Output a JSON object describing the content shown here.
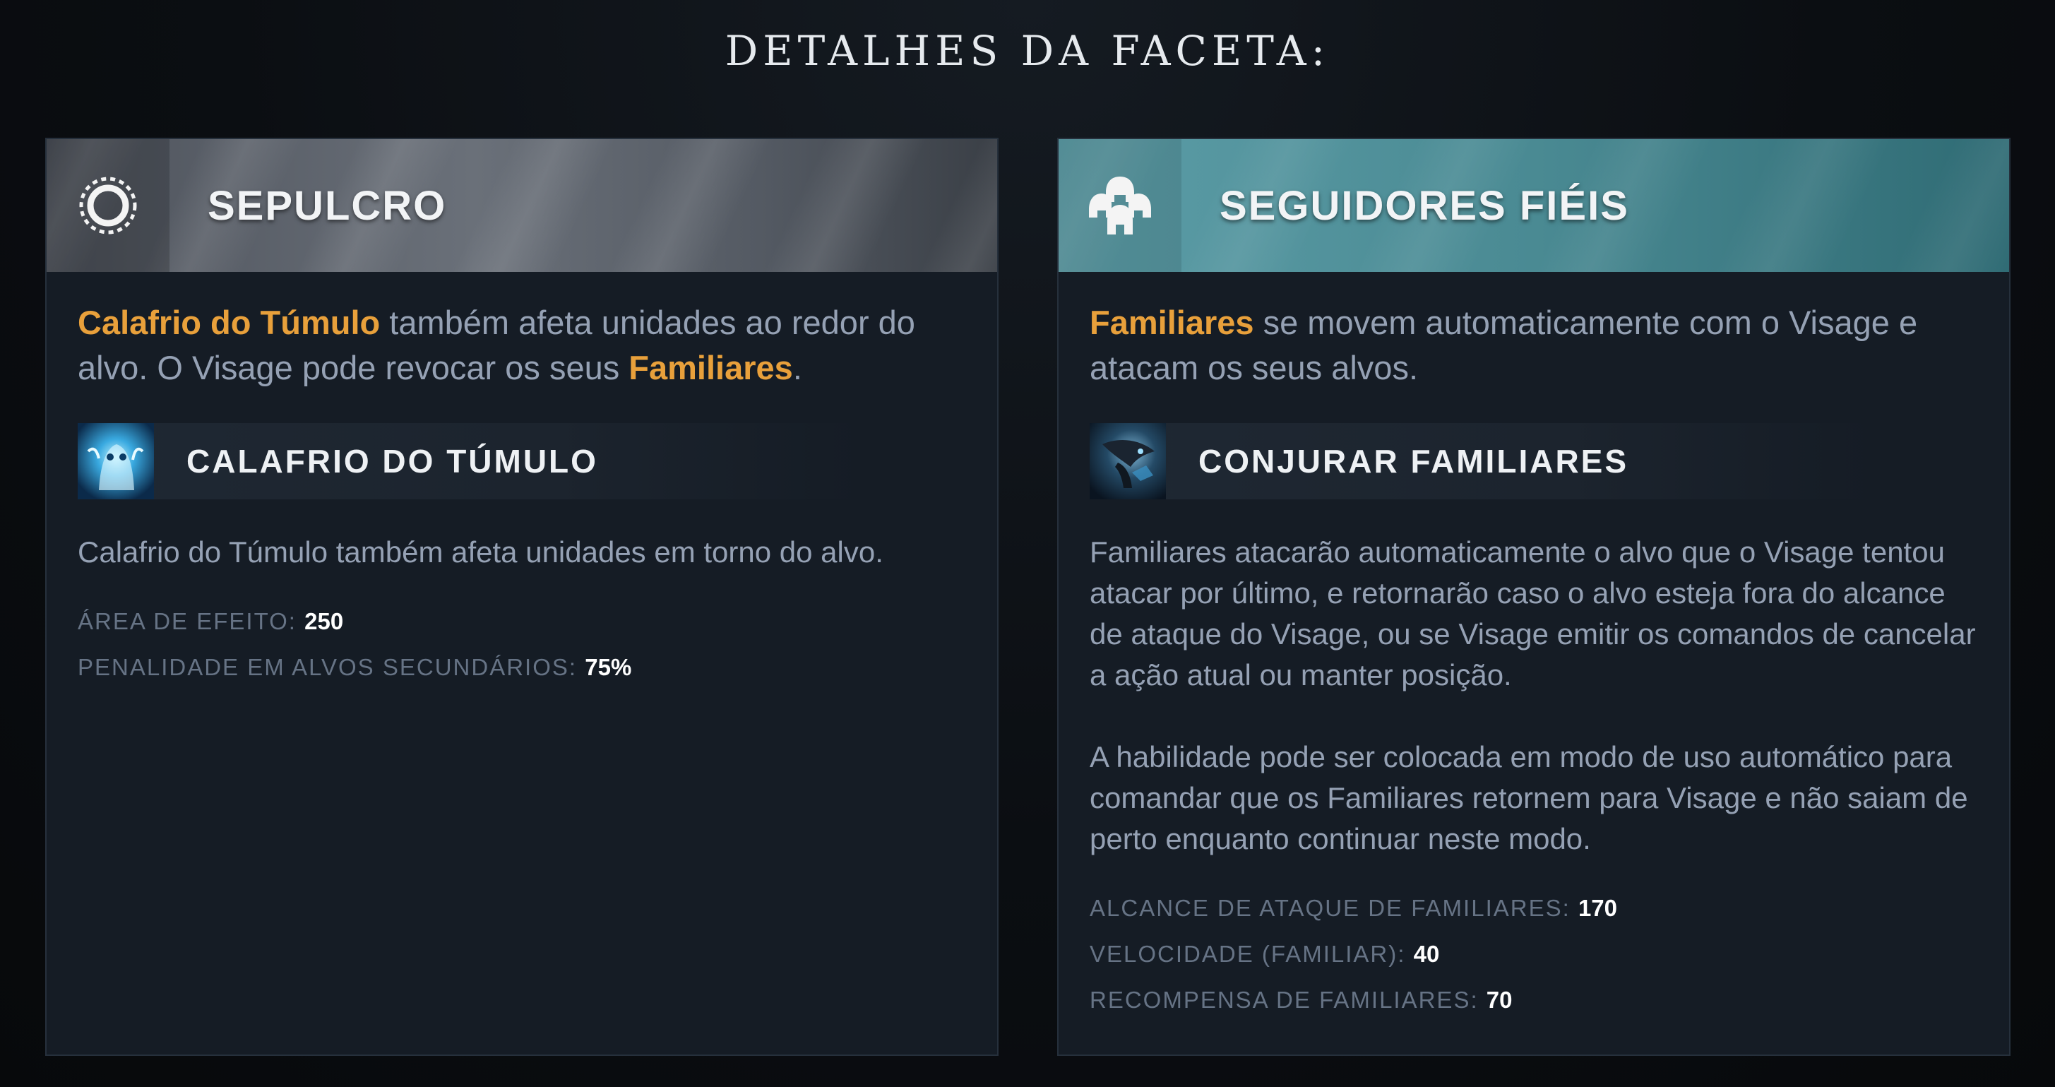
{
  "page": {
    "title": "DETALHES DA FACETA:"
  },
  "colors": {
    "highlight": "#e8a03b",
    "left_header": "#5a6069",
    "right_header": "#4a8a93",
    "card_bg": "#151c25"
  },
  "left_card": {
    "icon": "circle-ring-icon",
    "title": "SEPULCRO",
    "desc_parts": [
      {
        "text": "Calafrio do Túmulo",
        "highlight": true
      },
      {
        "text": " também afeta unidades ao redor do alvo. O Visage pode revocar os seus ",
        "highlight": false
      },
      {
        "text": "Familiares",
        "highlight": true
      },
      {
        "text": ".",
        "highlight": false
      }
    ],
    "ability": {
      "icon": "grave-chill-icon",
      "name": "CALAFRIO DO TÚMULO",
      "description": "Calafrio do Túmulo também afeta unidades em torno do alvo.",
      "stats": [
        {
          "label": "ÁREA DE EFEITO:",
          "value": "250"
        },
        {
          "label": "PENALIDADE EM ALVOS SECUNDÁRIOS:",
          "value": "75%"
        }
      ]
    }
  },
  "right_card": {
    "icon": "helmets-group-icon",
    "title": "SEGUIDORES FIÉIS",
    "desc_parts": [
      {
        "text": "Familiares",
        "highlight": true
      },
      {
        "text": " se movem automaticamente com o Visage e atacam os seus alvos.",
        "highlight": false
      }
    ],
    "ability": {
      "icon": "summon-familiars-icon",
      "name": "CONJURAR FAMILIARES",
      "description": "Familiares atacarão automaticamente o alvo que o Visage tentou atacar por último, e retornarão caso o alvo esteja fora do alcance de ataque do Visage, ou se Visage emitir os comandos de cancelar a ação atual ou manter posição.\n\nA habilidade pode ser colocada em modo de uso automático para comandar que os Familiares retornem para Visage e não saiam de perto enquanto continuar neste modo.",
      "stats": [
        {
          "label": "ALCANCE DE ATAQUE DE FAMILIARES:",
          "value": "170"
        },
        {
          "label": "VELOCIDADE (FAMILIAR):",
          "value": "40"
        },
        {
          "label": "RECOMPENSA DE FAMILIARES:",
          "value": "70"
        }
      ]
    }
  }
}
